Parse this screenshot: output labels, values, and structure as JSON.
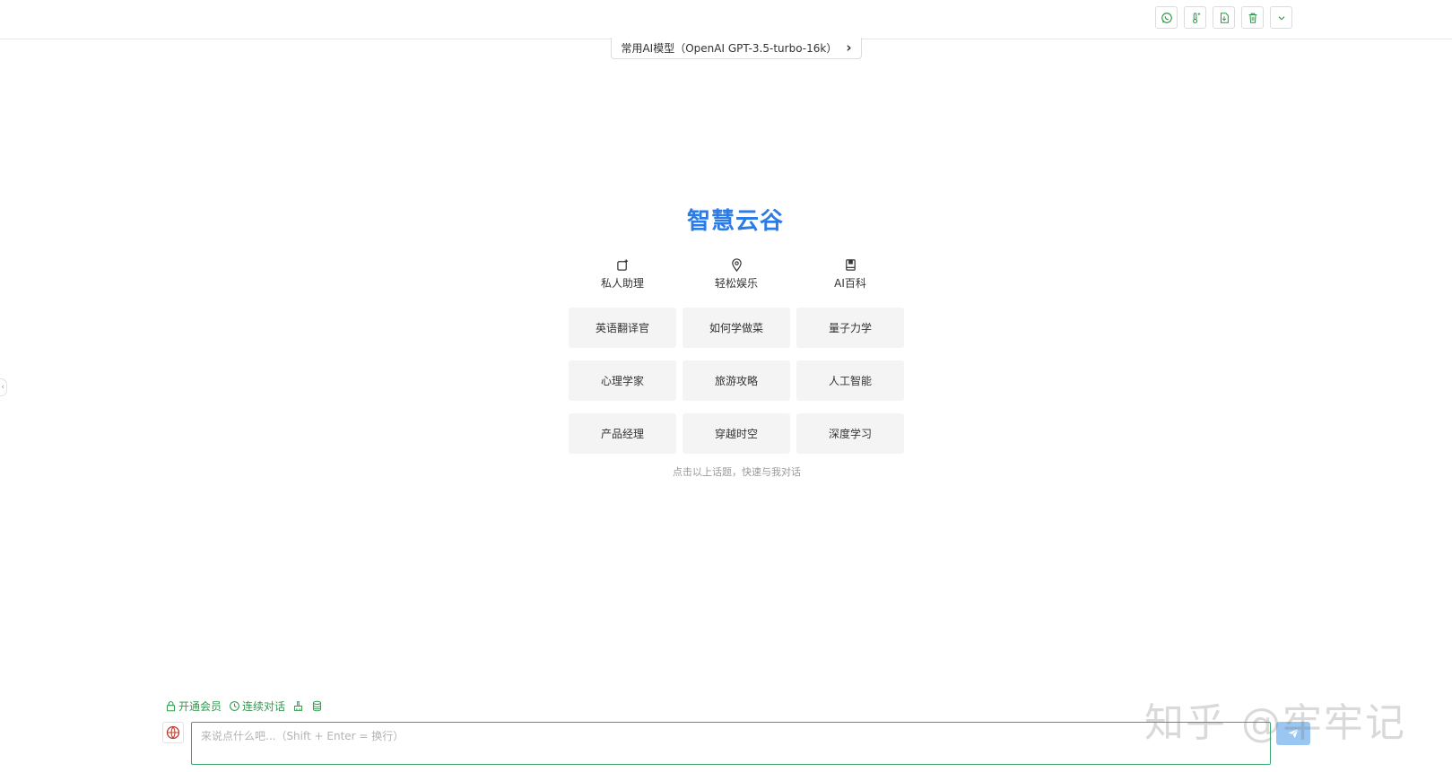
{
  "header": {
    "actions": [
      {
        "icon": "whatsapp-chat-icon"
      },
      {
        "icon": "thermometer-icon"
      },
      {
        "icon": "document-export-icon"
      },
      {
        "icon": "trash-icon"
      },
      {
        "icon": "chevron-down-icon"
      }
    ]
  },
  "model_selector": {
    "label": "常用AI模型（OpenAI GPT-3.5-turbo-16k）",
    "chevron": "›"
  },
  "welcome": {
    "title": "智慧云谷",
    "categories": [
      {
        "label": "私人助理",
        "icon": "edit-note-icon"
      },
      {
        "label": "轻松娱乐",
        "icon": "map-pin-icon"
      },
      {
        "label": "AI百科",
        "icon": "book-icon"
      }
    ],
    "topics": [
      "英语翻译官",
      "如何学做菜",
      "量子力学",
      "心理学家",
      "旅游攻略",
      "人工智能",
      "产品经理",
      "穿越时空",
      "深度学习"
    ],
    "hint": "点击以上话题，快速与我对话"
  },
  "bottom_tools": {
    "vip_label": "开通会员",
    "continuous_label": "连续对话"
  },
  "input": {
    "placeholder": "来说点什么吧...（Shift + Enter = 换行）"
  },
  "watermark": "知乎 @牢牢记",
  "colors": {
    "accent_blue": "#2d7be5",
    "accent_green": "#2f9a4d",
    "send_button": "#9ac6f2"
  }
}
